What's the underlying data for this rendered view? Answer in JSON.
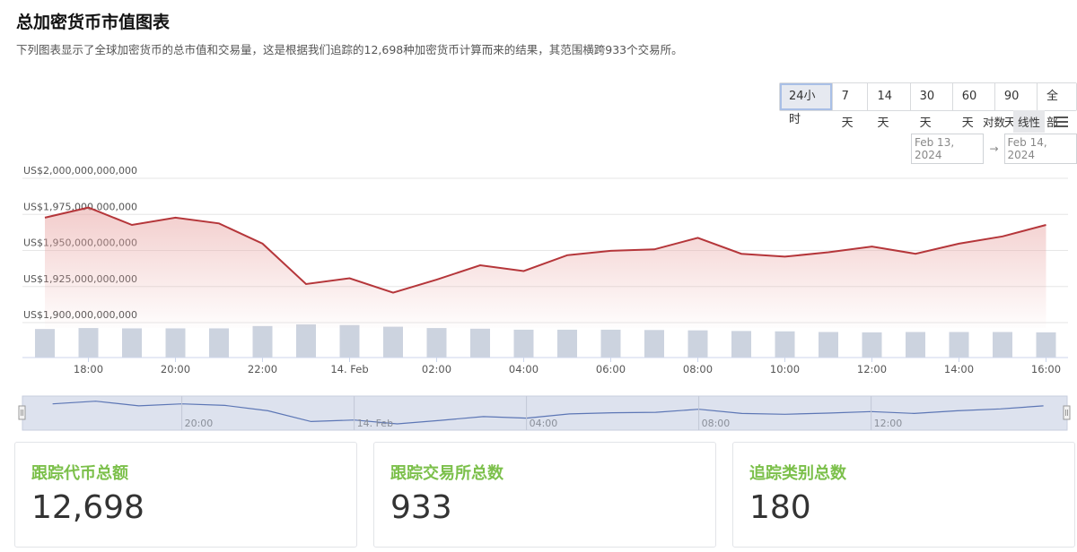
{
  "page": {
    "title": "总加密货币市值图表",
    "subtitle": "下列图表显示了全球加密货币的总市值和交易量，这是根据我们追踪的12,698种加密货币计算而来的结果，其范围横跨933个交易所。"
  },
  "controls": {
    "ranges": [
      "24小时",
      "7天",
      "14天",
      "30天",
      "60天",
      "90天",
      "全部"
    ],
    "active_range": "24小时",
    "scale_options": [
      "对数",
      "线性"
    ],
    "active_scale": "线性",
    "menu_icon": "hamburger-menu-icon",
    "date_from": "Feb 13, 2024",
    "date_to": "Feb 14, 2024",
    "date_arrow": "→"
  },
  "chart_data": {
    "type": "area",
    "y_tick_labels": [
      "US$1,900,000,000,000",
      "US$1,925,000,000,000",
      "US$1,950,000,000,000",
      "US$1,975,000,000,000",
      "US$2,000,000,000,000"
    ],
    "ylim": [
      1900000000000,
      2000000000000
    ],
    "x_tick_labels": [
      "18:00",
      "20:00",
      "22:00",
      "14. Feb",
      "02:00",
      "04:00",
      "06:00",
      "08:00",
      "10:00",
      "12:00",
      "14:00",
      "16:00"
    ],
    "navigator_tick_labels": [
      "20:00",
      "14. Feb",
      "04:00",
      "08:00",
      "12:00"
    ],
    "series": [
      {
        "x": [
          17,
          18,
          19,
          20,
          21,
          22,
          23,
          24,
          25,
          26,
          27,
          28,
          29,
          30,
          31,
          32,
          33,
          34,
          35,
          36,
          37,
          38,
          39,
          40
        ],
        "values": [
          1969000000000,
          1976000000000,
          1964000000000,
          1969000000000,
          1965000000000,
          1951000000000,
          1923000000000,
          1927000000000,
          1917000000000,
          1926000000000,
          1936000000000,
          1932000000000,
          1943000000000,
          1946000000000,
          1947000000000,
          1955000000000,
          1944000000000,
          1942000000000,
          1945000000000,
          1949000000000,
          1944000000000,
          1951000000000,
          1956000000000,
          1964000000000
        ]
      }
    ],
    "volume_relative": [
      0.86,
      0.89,
      0.88,
      0.88,
      0.88,
      0.95,
      1.0,
      0.98,
      0.93,
      0.89,
      0.87,
      0.84,
      0.84,
      0.84,
      0.83,
      0.82,
      0.8,
      0.79,
      0.77,
      0.76,
      0.77,
      0.77,
      0.77,
      0.76
    ],
    "colors": {
      "line": "#b5363a",
      "area_top": "#e8a3a1",
      "volume_bar": "#ccd3df",
      "navigator_fill": "#dde2ee",
      "navigator_line": "#5c76b5",
      "grid": "#e6e6e6"
    },
    "grid": true
  },
  "stats": [
    {
      "label": "跟踪代币总额",
      "value": "12,698"
    },
    {
      "label": "跟踪交易所总数",
      "value": "933"
    },
    {
      "label": "追踪类别总数",
      "value": "180"
    }
  ],
  "accent_color": "#7cc04b"
}
